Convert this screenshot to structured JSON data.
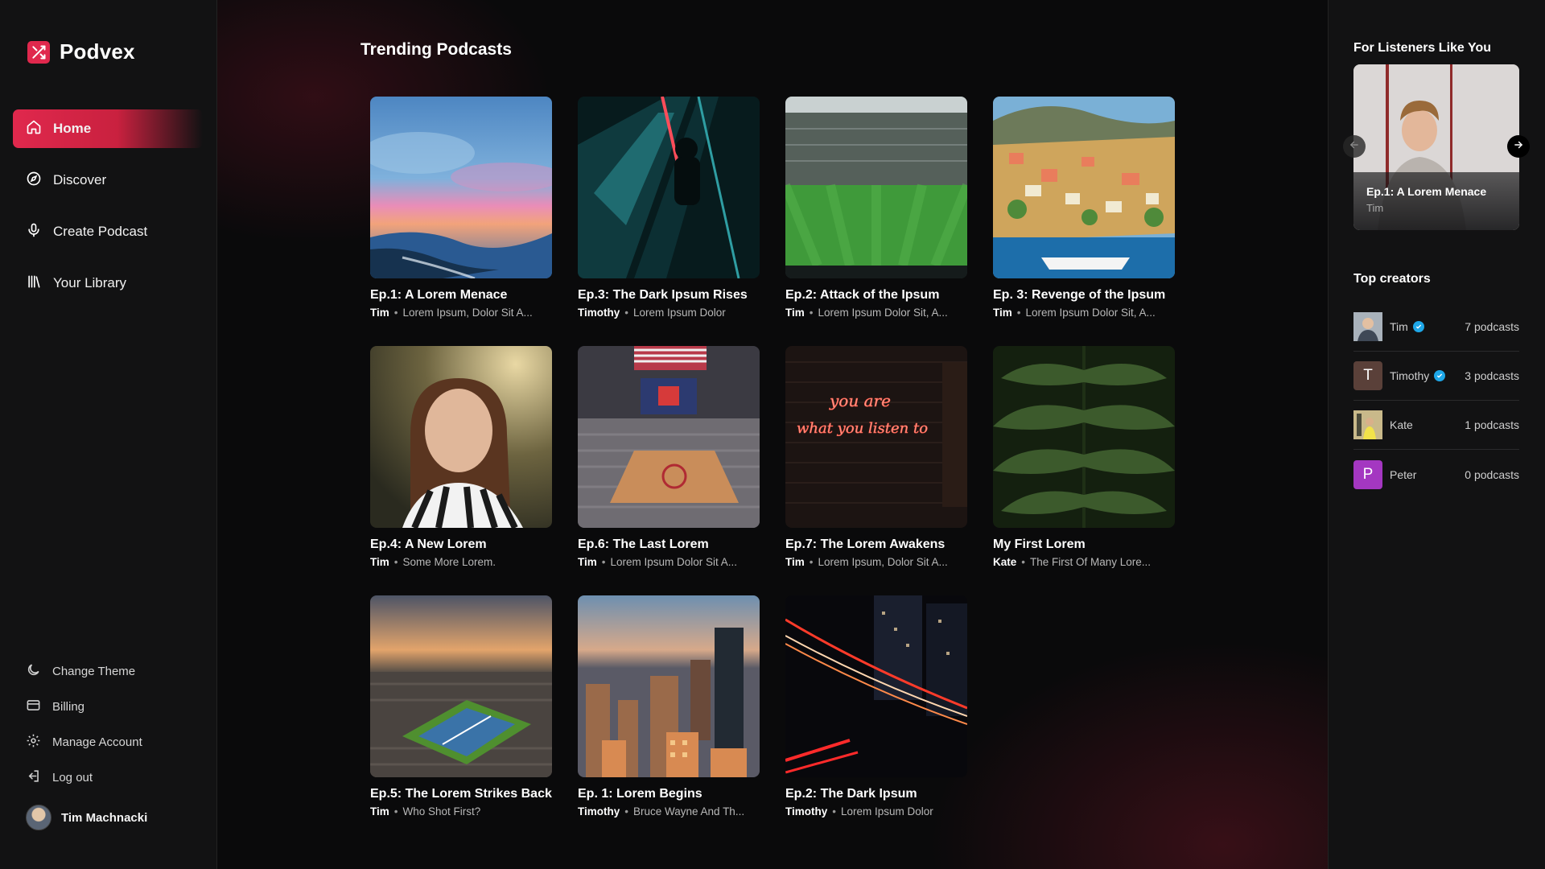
{
  "brand": {
    "name": "Podvex",
    "accent": "#e0284d"
  },
  "nav": {
    "items": [
      {
        "label": "Home",
        "icon": "home-icon",
        "active": true
      },
      {
        "label": "Discover",
        "icon": "compass-icon"
      },
      {
        "label": "Create Podcast",
        "icon": "microphone-icon"
      },
      {
        "label": "Your Library",
        "icon": "library-icon"
      }
    ]
  },
  "bottom_nav": {
    "items": [
      {
        "label": "Change Theme",
        "icon": "moon-icon"
      },
      {
        "label": "Billing",
        "icon": "credit-card-icon"
      },
      {
        "label": "Manage Account",
        "icon": "gear-icon"
      },
      {
        "label": "Log out",
        "icon": "logout-icon"
      }
    ]
  },
  "user": {
    "name": "Tim Machnacki"
  },
  "main": {
    "title": "Trending Podcasts",
    "cards": [
      {
        "title": "Ep.1: A Lorem Menace",
        "author": "Tim",
        "desc": "Lorem Ipsum, Dolor Sit A...",
        "art": "sunset-sea"
      },
      {
        "title": "Ep.3: The Dark Ipsum Rises",
        "author": "Timothy",
        "desc": "Lorem Ipsum Dolor",
        "art": "escalator"
      },
      {
        "title": "Ep.2: Attack of the Ipsum",
        "author": "Tim",
        "desc": "Lorem Ipsum Dolor Sit, A...",
        "art": "stadium"
      },
      {
        "title": "Ep. 3: Revenge of the Ipsum",
        "author": "Tim",
        "desc": "Lorem Ipsum Dolor Sit, A...",
        "art": "coastal-town"
      },
      {
        "title": "Ep.4: A New Lorem",
        "author": "Tim",
        "desc": "Some More Lorem.",
        "art": "portrait"
      },
      {
        "title": "Ep.6: The Last Lorem",
        "author": "Tim",
        "desc": "Lorem Ipsum Dolor Sit A...",
        "art": "arena"
      },
      {
        "title": "Ep.7: The Lorem Awakens",
        "author": "Tim",
        "desc": "Lorem Ipsum, Dolor Sit A...",
        "art": "neon-sign",
        "neon_text": [
          "you are",
          "what you listen to"
        ]
      },
      {
        "title": "My First Lorem",
        "author": "Kate",
        "desc": "The First Of Many Lore...",
        "art": "leaves"
      },
      {
        "title": "Ep.5: The Lorem Strikes Back",
        "author": "Tim",
        "desc": "Who Shot First?",
        "art": "tennis"
      },
      {
        "title": "Ep. 1: Lorem Begins",
        "author": "Timothy",
        "desc": "Bruce Wayne And Th...",
        "art": "city"
      },
      {
        "title": "Ep.2: The Dark Ipsum",
        "author": "Timothy",
        "desc": "Lorem Ipsum Dolor",
        "art": "light-trails"
      }
    ]
  },
  "right_panel": {
    "for_listeners_title": "For Listeners Like You",
    "featured": {
      "title": "Ep.1: A Lorem Menace",
      "author": "Tim"
    },
    "top_creators_title": "Top creators",
    "creators": [
      {
        "name": "Tim",
        "verified": true,
        "count": "7 podcasts",
        "avatar_letter": "",
        "avatar_color": "#6b7a8a"
      },
      {
        "name": "Timothy",
        "verified": true,
        "count": "3 podcasts",
        "avatar_letter": "T",
        "avatar_color": "#5a4039"
      },
      {
        "name": "Kate",
        "verified": false,
        "count": "1 podcasts",
        "avatar_letter": "",
        "avatar_color": "#8a7c52"
      },
      {
        "name": "Peter",
        "verified": false,
        "count": "0 podcasts",
        "avatar_letter": "P",
        "avatar_color": "#a437c1"
      }
    ]
  }
}
